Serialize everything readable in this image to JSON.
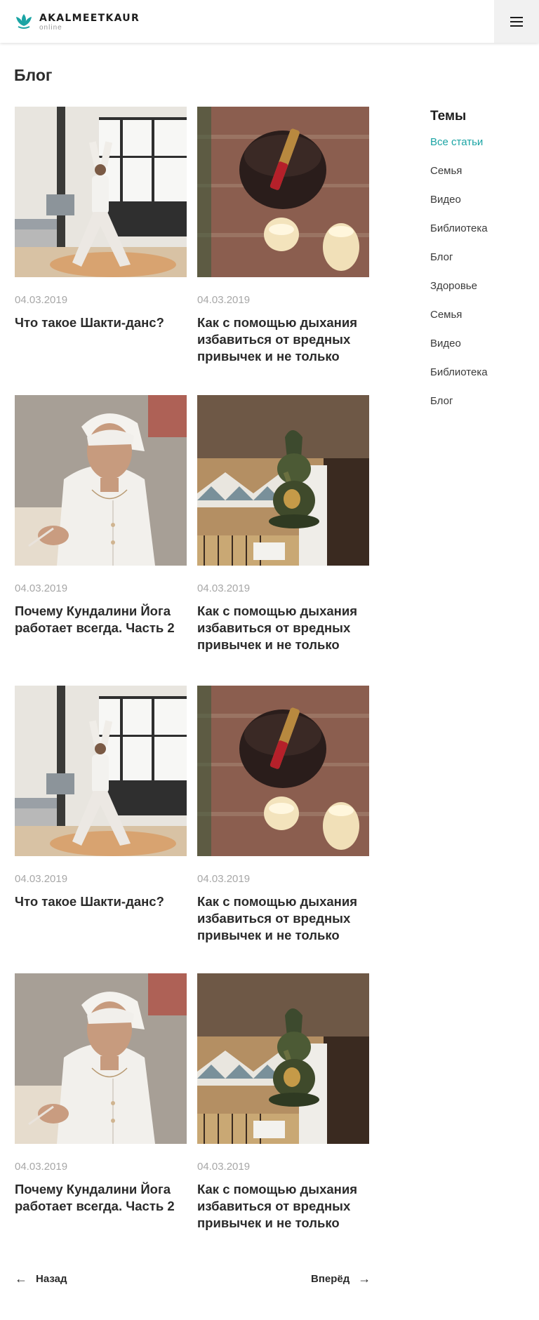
{
  "header": {
    "brand": "AKALMEETKAUR",
    "brand_sub": "online",
    "logo_icon": "lotus-icon",
    "menu_icon": "hamburger-icon",
    "accent_color": "#1aa4a4"
  },
  "page_title": "Блог",
  "posts": [
    {
      "date": "04.03.2019",
      "title": "Что такое Шакти-данс?",
      "image": "yoga-pose-photo"
    },
    {
      "date": "04.03.2019",
      "title": "Как с помощью дыхания избавиться от вредных привычек и не только",
      "image": "singing-bowl-candles-photo"
    },
    {
      "date": "04.03.2019",
      "title": "Почему Кундалини Йога работает всегда. Часть 2",
      "image": "meditation-woman-photo"
    },
    {
      "date": "04.03.2019",
      "title": "Как с помощью дыхания избавиться от вредных привычек и не только",
      "image": "ganesha-statue-photo"
    },
    {
      "date": "04.03.2019",
      "title": "Что такое Шакти-данс?",
      "image": "yoga-pose-photo"
    },
    {
      "date": "04.03.2019",
      "title": "Как с помощью дыхания избавиться от вредных привычек и не только",
      "image": "singing-bowl-candles-photo"
    },
    {
      "date": "04.03.2019",
      "title": "Почему Кундалини Йога работает всегда. Часть 2",
      "image": "meditation-woman-photo"
    },
    {
      "date": "04.03.2019",
      "title": "Как с помощью дыхания избавиться от вредных привычек и не только",
      "image": "ganesha-statue-photo"
    }
  ],
  "topics": {
    "heading": "Темы",
    "items": [
      "Все статьи",
      "Семья",
      "Видео",
      "Библиотека",
      "Блог",
      "Здоровье",
      "Семья",
      "Видео",
      "Библиотека",
      "Блог"
    ],
    "active_index": 0
  },
  "pagination": {
    "prev_label": "Назад",
    "next_label": "Вперёд",
    "prev_icon": "arrow-left-icon",
    "next_icon": "arrow-right-icon"
  }
}
